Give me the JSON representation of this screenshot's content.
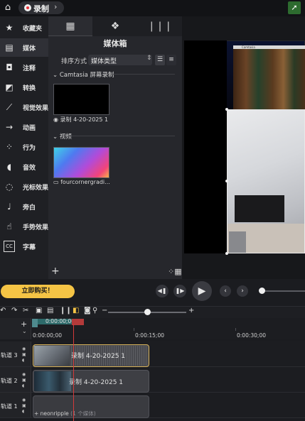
{
  "topbar": {
    "record_label": "录制",
    "home_icon": "home-icon",
    "cursor_icon": "cursor-icon"
  },
  "sidebar": {
    "items": [
      {
        "label": "收藏夹",
        "icon": "star-icon",
        "glyph": "★"
      },
      {
        "label": "媒体",
        "icon": "film-icon",
        "glyph": "▤",
        "active": true
      },
      {
        "label": "注释",
        "icon": "annotation-icon",
        "glyph": "◘"
      },
      {
        "label": "转换",
        "icon": "transition-icon",
        "glyph": "◩"
      },
      {
        "label": "视觉效果",
        "icon": "wand-icon",
        "glyph": "⟋"
      },
      {
        "label": "动画",
        "icon": "animation-icon",
        "glyph": "→"
      },
      {
        "label": "行为",
        "icon": "behavior-icon",
        "glyph": "⁘"
      },
      {
        "label": "音效",
        "icon": "speaker-icon",
        "glyph": "◖"
      },
      {
        "label": "光标效果",
        "icon": "cursor-effect-icon",
        "glyph": "◌"
      },
      {
        "label": "旁白",
        "icon": "microphone-icon",
        "glyph": "♩"
      },
      {
        "label": "手势效果",
        "icon": "gesture-icon",
        "glyph": "☝"
      },
      {
        "label": "字幕",
        "icon": "cc-icon",
        "glyph": "CC"
      }
    ]
  },
  "panel": {
    "tabs": [
      {
        "name": "media-bin-tab",
        "icon": "film-strip-icon",
        "glyph": "▦"
      },
      {
        "name": "library-tab",
        "icon": "cubes-icon",
        "glyph": "❖"
      },
      {
        "name": "favorites-tab",
        "icon": "books-icon",
        "glyph": "❘❘❘"
      }
    ],
    "title": "媒体箱",
    "sort_label": "排序方式",
    "sort_value": "媒体类型",
    "groups": [
      {
        "title": "Camtasia 屏幕录制",
        "caption": "录制 4-20-2025 1"
      },
      {
        "title": "视频",
        "caption": "fourcornergradi..."
      }
    ]
  },
  "canvas": {
    "recording_bar_label": "Camtasia"
  },
  "transport": {
    "buy_label": "立即购买！"
  },
  "timeline": {
    "timecode": "0:00:00;00",
    "ticks": [
      "0:00:00;00",
      "0:00:15;00",
      "0:00:30;00"
    ],
    "tracks": [
      {
        "name": "轨道 3",
        "clip": "录制 4-20-2025 1"
      },
      {
        "name": "轨道 2",
        "clip": "录制 4-20-2025 1"
      },
      {
        "name": "轨道 1",
        "clip": "+ neonripple",
        "clip_count": "(1 个媒体)"
      }
    ]
  },
  "colors": {
    "accent": "#f5c445",
    "record": "#e8343a",
    "playhead": "#d33a3a",
    "selected_clip_border": "#d9b45b"
  }
}
